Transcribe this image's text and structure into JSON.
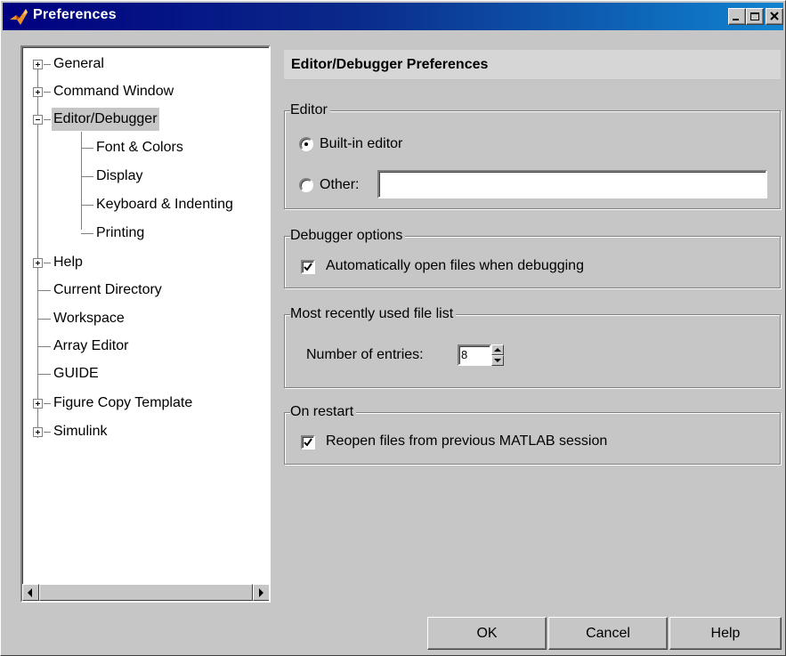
{
  "window": {
    "title": "Preferences"
  },
  "tree": {
    "items": [
      {
        "label": "General",
        "expander": "plus"
      },
      {
        "label": "Command Window",
        "expander": "plus"
      },
      {
        "label": "Editor/Debugger",
        "expander": "minus",
        "selected": true
      },
      {
        "label": "Font & Colors"
      },
      {
        "label": "Display"
      },
      {
        "label": "Keyboard & Indenting"
      },
      {
        "label": "Printing"
      },
      {
        "label": "Help",
        "expander": "plus"
      },
      {
        "label": "Current Directory"
      },
      {
        "label": "Workspace"
      },
      {
        "label": "Array Editor"
      },
      {
        "label": "GUIDE"
      },
      {
        "label": "Figure Copy Template",
        "expander": "plus"
      },
      {
        "label": "Simulink",
        "expander": "plus"
      }
    ]
  },
  "pane": {
    "title": "Editor/Debugger Preferences",
    "editor": {
      "title": "Editor",
      "builtin_label": "Built-in editor",
      "builtin_selected": true,
      "other_label": "Other:",
      "other_value": ""
    },
    "debugger": {
      "title": "Debugger options",
      "auto_open_label": "Automatically open files when debugging",
      "auto_open_checked": true
    },
    "mru": {
      "title": "Most recently used file list",
      "entries_label": "Number of entries:",
      "entries_value": "8"
    },
    "restart": {
      "title": "On restart",
      "reopen_label": "Reopen files from previous MATLAB session",
      "reopen_checked": true
    }
  },
  "buttons": {
    "ok": "OK",
    "cancel": "Cancel",
    "help": "Help"
  },
  "colors": {
    "title_bar_start": "#000080",
    "title_bar_end": "#1084d0",
    "face": "#c6c6c6"
  }
}
